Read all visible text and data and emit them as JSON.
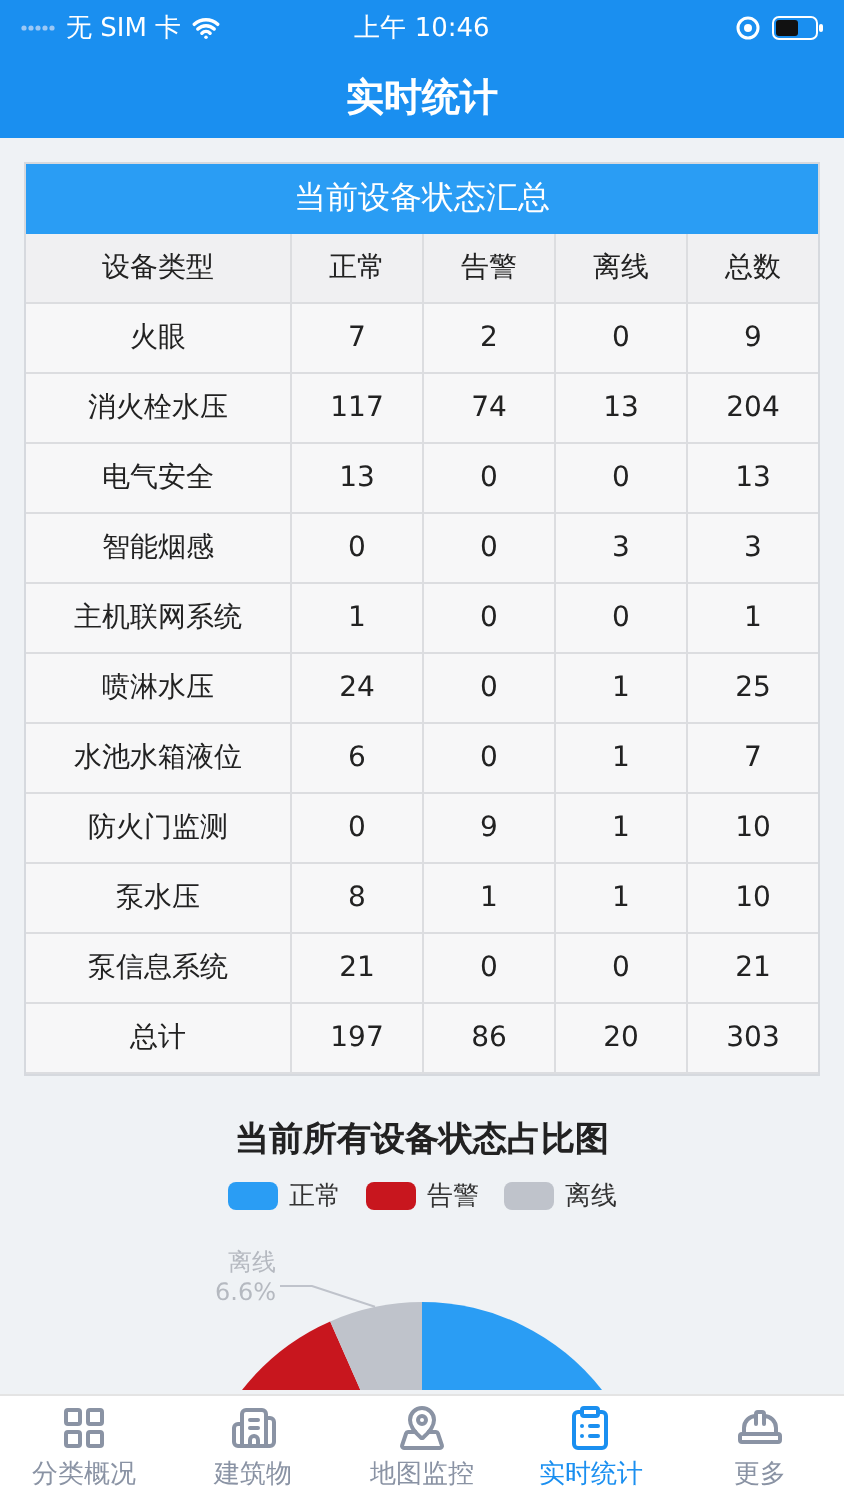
{
  "status_bar": {
    "carrier": "无 SIM 卡",
    "time": "上午 10:46"
  },
  "nav": {
    "title": "实时统计"
  },
  "table": {
    "title": "当前设备状态汇总",
    "columns": [
      "设备类型",
      "正常",
      "告警",
      "离线",
      "总数"
    ],
    "rows": [
      [
        "火眼",
        "7",
        "2",
        "0",
        "9"
      ],
      [
        "消火栓水压",
        "117",
        "74",
        "13",
        "204"
      ],
      [
        "电气安全",
        "13",
        "0",
        "0",
        "13"
      ],
      [
        "智能烟感",
        "0",
        "0",
        "3",
        "3"
      ],
      [
        "主机联网系统",
        "1",
        "0",
        "0",
        "1"
      ],
      [
        "喷淋水压",
        "24",
        "0",
        "1",
        "25"
      ],
      [
        "水池水箱液位",
        "6",
        "0",
        "1",
        "7"
      ],
      [
        "防火门监测",
        "0",
        "9",
        "1",
        "10"
      ],
      [
        "泵水压",
        "8",
        "1",
        "1",
        "10"
      ],
      [
        "泵信息系统",
        "21",
        "0",
        "0",
        "21"
      ],
      [
        "总计",
        "197",
        "86",
        "20",
        "303"
      ]
    ]
  },
  "chart": {
    "title": "当前所有设备状态占比图",
    "legend": [
      {
        "label": "正常",
        "color": "#2a9df4"
      },
      {
        "label": "告警",
        "color": "#c8161e"
      },
      {
        "label": "离线",
        "color": "#bfc3cb"
      }
    ],
    "slice_label": {
      "name": "离线",
      "percent": "6.6%"
    }
  },
  "tabs": [
    {
      "label": "分类概况",
      "selected": false
    },
    {
      "label": "建筑物",
      "selected": false
    },
    {
      "label": "地图监控",
      "selected": false
    },
    {
      "label": "实时统计",
      "selected": true
    },
    {
      "label": "更多",
      "selected": false
    }
  ]
}
